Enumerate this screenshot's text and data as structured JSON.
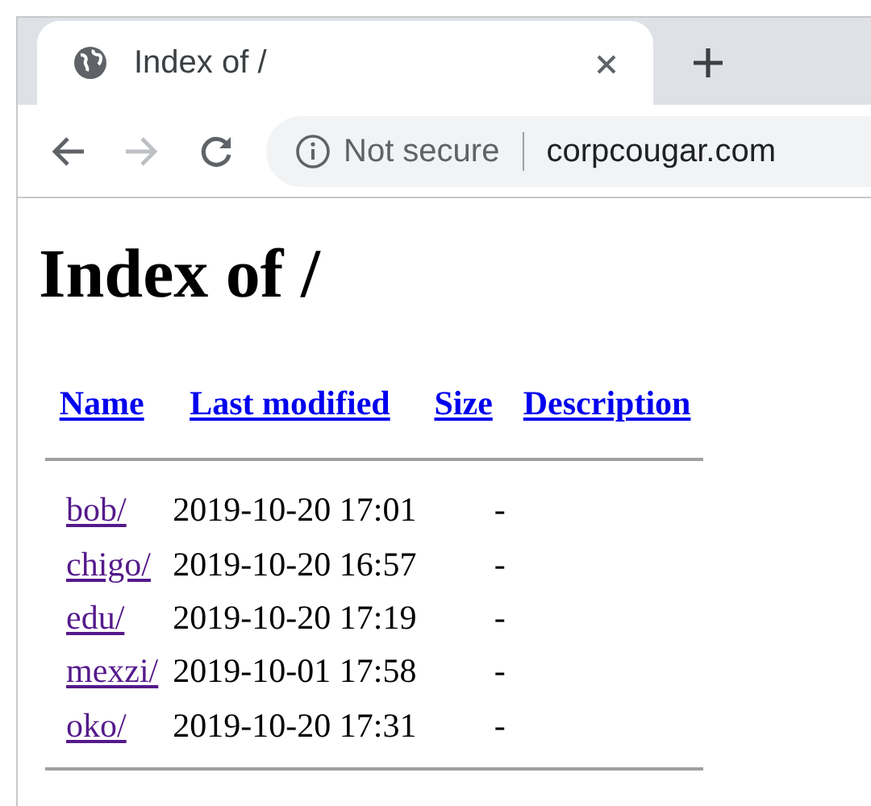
{
  "tab": {
    "title": "Index of /",
    "selected": true
  },
  "address_bar": {
    "security": "Not secure",
    "url": "corpcougar.com"
  },
  "page": {
    "heading": "Index of /",
    "columns": [
      {
        "label": "Name"
      },
      {
        "label": "Last modified"
      },
      {
        "label": "Size"
      },
      {
        "label": "Description"
      }
    ],
    "rows": [
      {
        "name": "bob/",
        "modified": "2019-10-20 17:01",
        "size": "-",
        "visited": true
      },
      {
        "name": "chigo/",
        "modified": "2019-10-20 16:57",
        "size": "-",
        "visited": true
      },
      {
        "name": "edu/",
        "modified": "2019-10-20 17:19",
        "size": "-",
        "visited": true
      },
      {
        "name": "mexzi/",
        "modified": "2019-10-01 17:58",
        "size": "-",
        "visited": true
      },
      {
        "name": "oko/",
        "modified": "2019-10-20 17:31",
        "size": "-",
        "visited": true
      }
    ]
  }
}
